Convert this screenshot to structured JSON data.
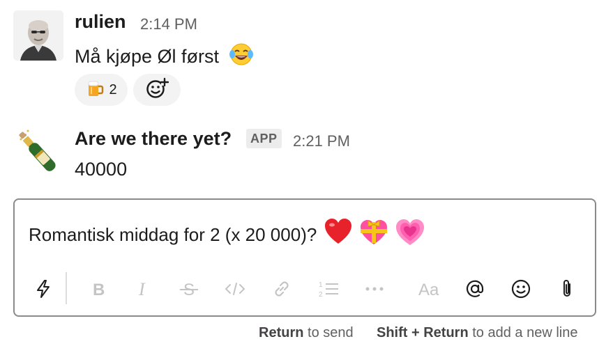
{
  "messages": [
    {
      "author": "rulien",
      "time": "2:14 PM",
      "text": "Må kjøpe Øl først",
      "reactions": [
        {
          "emoji": "beer-mug",
          "count": "2"
        }
      ]
    },
    {
      "author": "Are we there yet?",
      "badge": "APP",
      "time": "2:21 PM",
      "text": "40000"
    }
  ],
  "composer": {
    "text": "Romantisk middag for 2 (x 20 000)?",
    "emojis": [
      "red-heart",
      "heart-with-ribbon",
      "growing-heart"
    ],
    "toolbar": [
      "shortcuts-icon",
      "bold-icon",
      "italic-icon",
      "strikethrough-icon",
      "code-icon",
      "link-icon",
      "numbered-list-icon",
      "more-icon",
      "formatting-icon",
      "mention-icon",
      "emoji-icon",
      "attachment-icon"
    ]
  },
  "hint": {
    "send_key": "Return",
    "send_text": "to send",
    "newline_key": "Shift + Return",
    "newline_text": "to add a new line"
  },
  "colors": {
    "text": "#1d1c1d",
    "muted": "#616061",
    "border": "#8a8a8a",
    "reaction_bg": "#f3f3f3"
  }
}
